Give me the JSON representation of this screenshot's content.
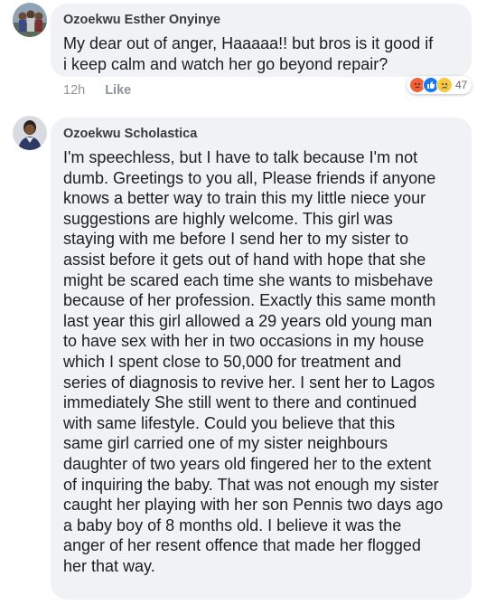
{
  "comments": [
    {
      "author": "Ozoekwu Esther Onyinye",
      "text": "My dear out of anger, Haaaaa!!  but bros is it good if\ni keep calm and watch her go beyond repair?",
      "time": "12h",
      "like_label": "Like",
      "reaction_count": "47",
      "reactions": [
        "angry-icon",
        "like-icon",
        "sad-icon"
      ]
    },
    {
      "author": "Ozoekwu Scholastica",
      "text": "I'm speechless, but I have to talk because I'm not\ndumb. Greetings to you all, Please friends if anyone\nknows a better way to train this my little niece your\nsuggestions are highly welcome. This girl was\nstaying with me before I send her to my sister to\nassist before it gets out of  hand with hope that she\nmight be scared each time she wants to misbehave\nbecause of her profession. Exactly this same month\nlast year this girl allowed a 29 years old young man\nto have sex with her in two occasions in my house\nwhich I spent close to 50,000 for treatment and\nseries of  diagnosis to revive her. I sent her to Lagos\nimmediately She still went to there and continued\nwith same lifestyle. Could you believe that this\nsame girl carried one of my sister neighbours\ndaughter of two years old fingered her to the extent\nof inquiring the baby. That was not enough my sister\ncaught her playing with her son Pennis two days ago\na baby boy of 8 months old. I believe it was the\nanger of her resent offence that made her flogged\nher that way."
    }
  ],
  "colors": {
    "bubble": "#f1f2f6",
    "author": "#3a3b3e",
    "text": "#1c1e21",
    "meta": "#8d949e",
    "angry": "#f0623a",
    "like": "#1877f2",
    "sad": "#f7c943"
  }
}
